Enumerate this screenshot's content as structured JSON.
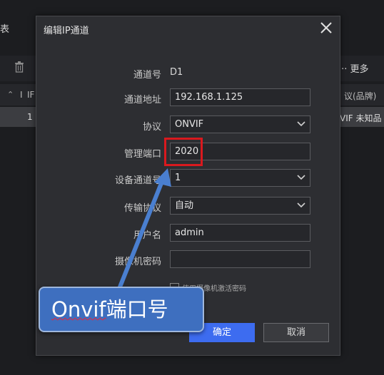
{
  "background": {
    "tab_fragment": "表",
    "more_label": "更多",
    "header_sort": "⌃",
    "header_col1": "I",
    "header_col2": "IF",
    "header_protocol": "议(品牌)",
    "row_index": "1",
    "row_protocol": "VIF 未知品"
  },
  "dialog": {
    "title": "编辑IP通道",
    "fields": {
      "channel_no_label": "通道号",
      "channel_no_value": "D1",
      "address_label": "通道地址",
      "address_value": "192.168.1.125",
      "protocol_label": "协议",
      "protocol_value": "ONVIF",
      "mgmt_port_label": "管理端口",
      "mgmt_port_value": "2020",
      "device_channel_label": "设备通道号",
      "device_channel_value": "1",
      "transport_label": "传输协议",
      "transport_value": "自动",
      "username_label": "用户名",
      "username_value": "admin",
      "camera_password_label": "摄像机密码",
      "camera_password_value": ""
    },
    "checkbox_label": "使用摄像机激活密码",
    "ok_label": "确定",
    "cancel_label": "取消"
  },
  "annotation": {
    "callout_underlined": "Onvif",
    "callout_rest": "端口号",
    "highlight_color": "#d9191e",
    "callout_color": "#3e6fbf"
  },
  "colors": {
    "accent": "#3d6cf0",
    "dialog_bg": "#2d2e32"
  }
}
